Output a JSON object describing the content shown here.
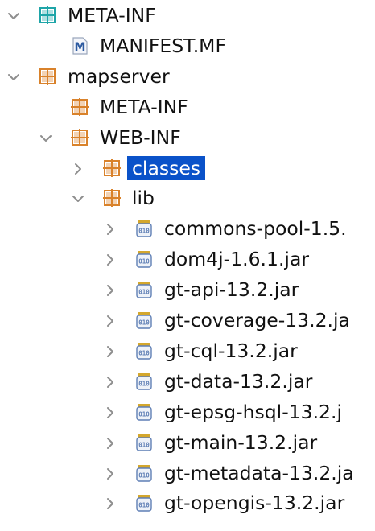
{
  "tree": {
    "items": [
      {
        "label": "META-INF",
        "depth": 0,
        "kind": "package-teal",
        "expanded": true
      },
      {
        "label": "MANIFEST.MF",
        "depth": 1,
        "kind": "manifest"
      },
      {
        "label": "mapserver",
        "depth": 0,
        "kind": "package",
        "expanded": true
      },
      {
        "label": "META-INF",
        "depth": 1,
        "kind": "package"
      },
      {
        "label": "WEB-INF",
        "depth": 1,
        "kind": "package",
        "expanded": true
      },
      {
        "label": "classes",
        "depth": 2,
        "kind": "package",
        "expanded": false,
        "selected": true
      },
      {
        "label": "lib",
        "depth": 2,
        "kind": "package",
        "expanded": true
      },
      {
        "label": "commons-pool-1.5.",
        "depth": 3,
        "kind": "jar",
        "expanded": false
      },
      {
        "label": "dom4j-1.6.1.jar",
        "depth": 3,
        "kind": "jar",
        "expanded": false
      },
      {
        "label": "gt-api-13.2.jar",
        "depth": 3,
        "kind": "jar",
        "expanded": false
      },
      {
        "label": "gt-coverage-13.2.ja",
        "depth": 3,
        "kind": "jar",
        "expanded": false
      },
      {
        "label": "gt-cql-13.2.jar",
        "depth": 3,
        "kind": "jar",
        "expanded": false
      },
      {
        "label": "gt-data-13.2.jar",
        "depth": 3,
        "kind": "jar",
        "expanded": false
      },
      {
        "label": "gt-epsg-hsql-13.2.j",
        "depth": 3,
        "kind": "jar",
        "expanded": false
      },
      {
        "label": "gt-main-13.2.jar",
        "depth": 3,
        "kind": "jar",
        "expanded": false
      },
      {
        "label": "gt-metadata-13.2.ja",
        "depth": 3,
        "kind": "jar",
        "expanded": false
      },
      {
        "label": "gt-opengis-13.2.jar",
        "depth": 3,
        "kind": "jar",
        "expanded": false
      }
    ]
  },
  "colors": {
    "selection": "#0a52c9",
    "twisty": "#8e8e8e",
    "package_orange": "#d9822b",
    "package_teal": "#1fa5a8",
    "manifest_blue": "#2c5aa0",
    "jar_gold": "#d4a72c",
    "jar_blue": "#5f7fb5"
  },
  "icons": {
    "package": "package-folder-icon",
    "package-teal": "source-folder-icon",
    "manifest": "manifest-file-icon",
    "jar": "jar-archive-icon"
  }
}
